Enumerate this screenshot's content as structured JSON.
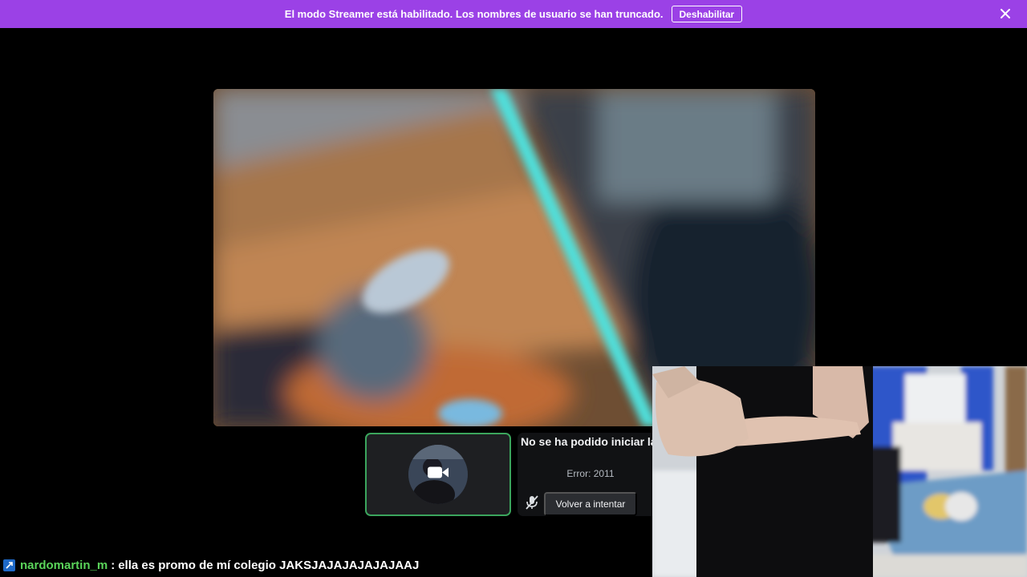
{
  "banner": {
    "message": "El modo Streamer está habilitado. Los nombres de usuario se han truncado.",
    "disable_label": "Deshabilitar",
    "close_icon": "close-icon",
    "background_color": "#9b41e6"
  },
  "call": {
    "participant_tile": {
      "avatar_icon": "avatar",
      "camera_icon": "video-camera-icon",
      "speaking_border_color": "#3ba55d"
    },
    "camera_error": {
      "title": "No se ha podido iniciar la cámara",
      "code": "Error: 2011",
      "retry_label": "Volver a intentar",
      "mute_icon": "microphone-muted-icon"
    }
  },
  "chat": {
    "badge_icon": "prime-badge-icon",
    "username": "nardomartin_m",
    "separator": ":",
    "message": "ella es promo de mí colegio JAKSJAJAJAJAJAJAAJ",
    "username_color": "#5ad45a"
  }
}
